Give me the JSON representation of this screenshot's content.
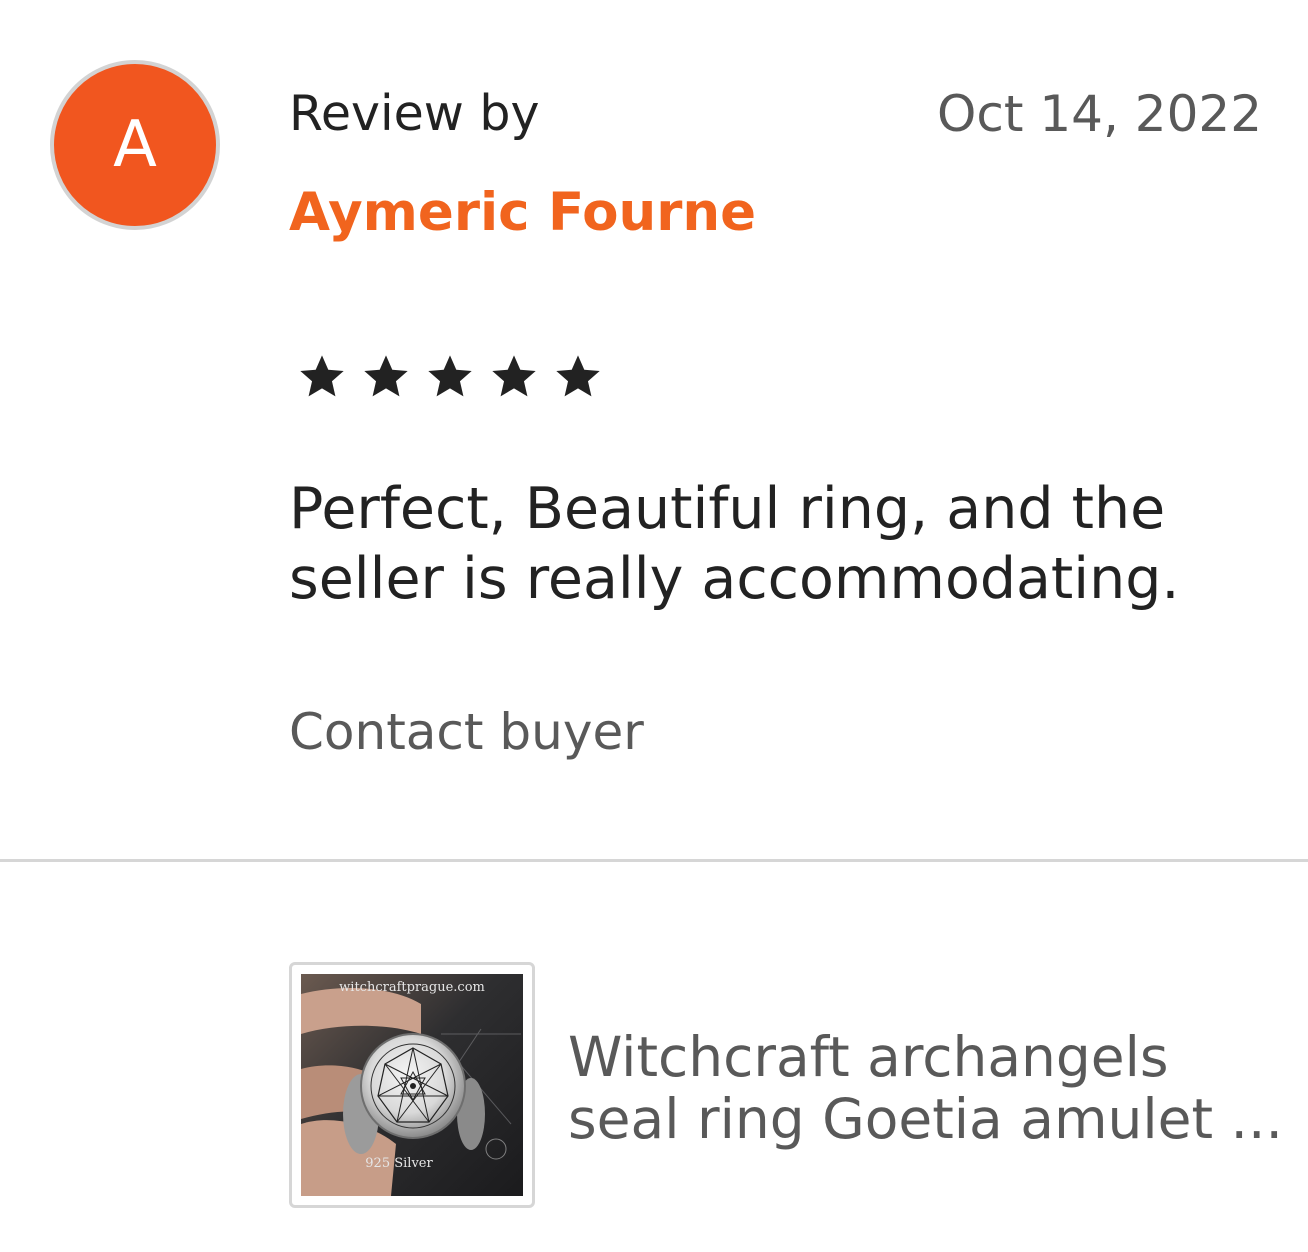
{
  "review": {
    "avatar_letter": "A",
    "heading": "Review by",
    "date": "Oct 14, 2022",
    "reviewer_name": "Aymeric Fourne",
    "rating": 5,
    "rating_max": 5,
    "text": "Perfect, Beautiful ring, and the seller is really accommodating.",
    "contact_label": "Contact buyer"
  },
  "listing": {
    "title_line1": "Witchcraft archangels",
    "title_line2": "seal ring Goetia amulet ...",
    "image_watermark": "witchcraftprague.com",
    "image_caption": "925 Silver"
  },
  "colors": {
    "avatar_bg": "#f1561f",
    "name_accent": "#f1641e",
    "star": "#222222",
    "muted_text": "#595959",
    "divider": "#d6d6d6"
  },
  "icons": {
    "star": "star-icon"
  }
}
